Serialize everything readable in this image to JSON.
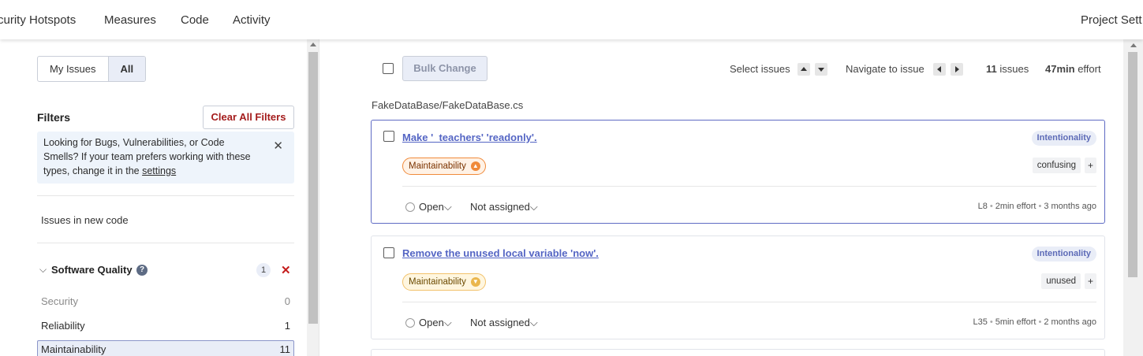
{
  "nav": {
    "items": [
      "curity Hotspots",
      "Measures",
      "Code",
      "Activity"
    ],
    "project_settings": "Project Sett"
  },
  "sidebar": {
    "toggle": {
      "my_issues": "My Issues",
      "all": "All"
    },
    "filters_title": "Filters",
    "clear_all": "Clear All Filters",
    "info": {
      "text": "Looking for Bugs, Vulnerabilities, or Code Smells? If your team prefers working with these types, change it in the ",
      "link": "settings",
      "close": "✕"
    },
    "new_code": "Issues in new code",
    "facet": {
      "name": "Software Quality",
      "help": "?",
      "count": "1",
      "remove": "✕",
      "rows": [
        {
          "label": "Security",
          "value": "0"
        },
        {
          "label": "Reliability",
          "value": "1"
        },
        {
          "label": "Maintainability",
          "value": "11"
        }
      ]
    }
  },
  "toolbar": {
    "bulk_change": "Bulk Change",
    "select_issues": "Select issues",
    "navigate": "Navigate to issue",
    "issues_count": "11",
    "issues_word": "issues",
    "effort_value": "47min",
    "effort_word": "effort"
  },
  "file_path": "FakeDataBase/FakeDataBase.cs",
  "issues": [
    {
      "title": "Make '_teachers' 'readonly'.",
      "attribute": "Intentionality",
      "quality": "Maintainability",
      "severity_icon": "chevron-up-icon",
      "tag": "confusing",
      "tag_add": "+",
      "status": "Open",
      "assignee": "Not assigned",
      "line": "L8",
      "effort": "2min effort",
      "age": "3 months ago",
      "quality_color": "#f08a3a"
    },
    {
      "title": "Remove the unused local variable 'now'.",
      "attribute": "Intentionality",
      "quality": "Maintainability",
      "severity_icon": "chevron-down-icon",
      "tag": "unused",
      "tag_add": "+",
      "status": "Open",
      "assignee": "Not assigned",
      "line": "L35",
      "effort": "5min effort",
      "age": "2 months ago",
      "quality_color": "#eab64d"
    }
  ],
  "colors": {
    "accent": "#5465c4",
    "danger": "#a41c1c",
    "selected_bg": "#e9edf7"
  }
}
